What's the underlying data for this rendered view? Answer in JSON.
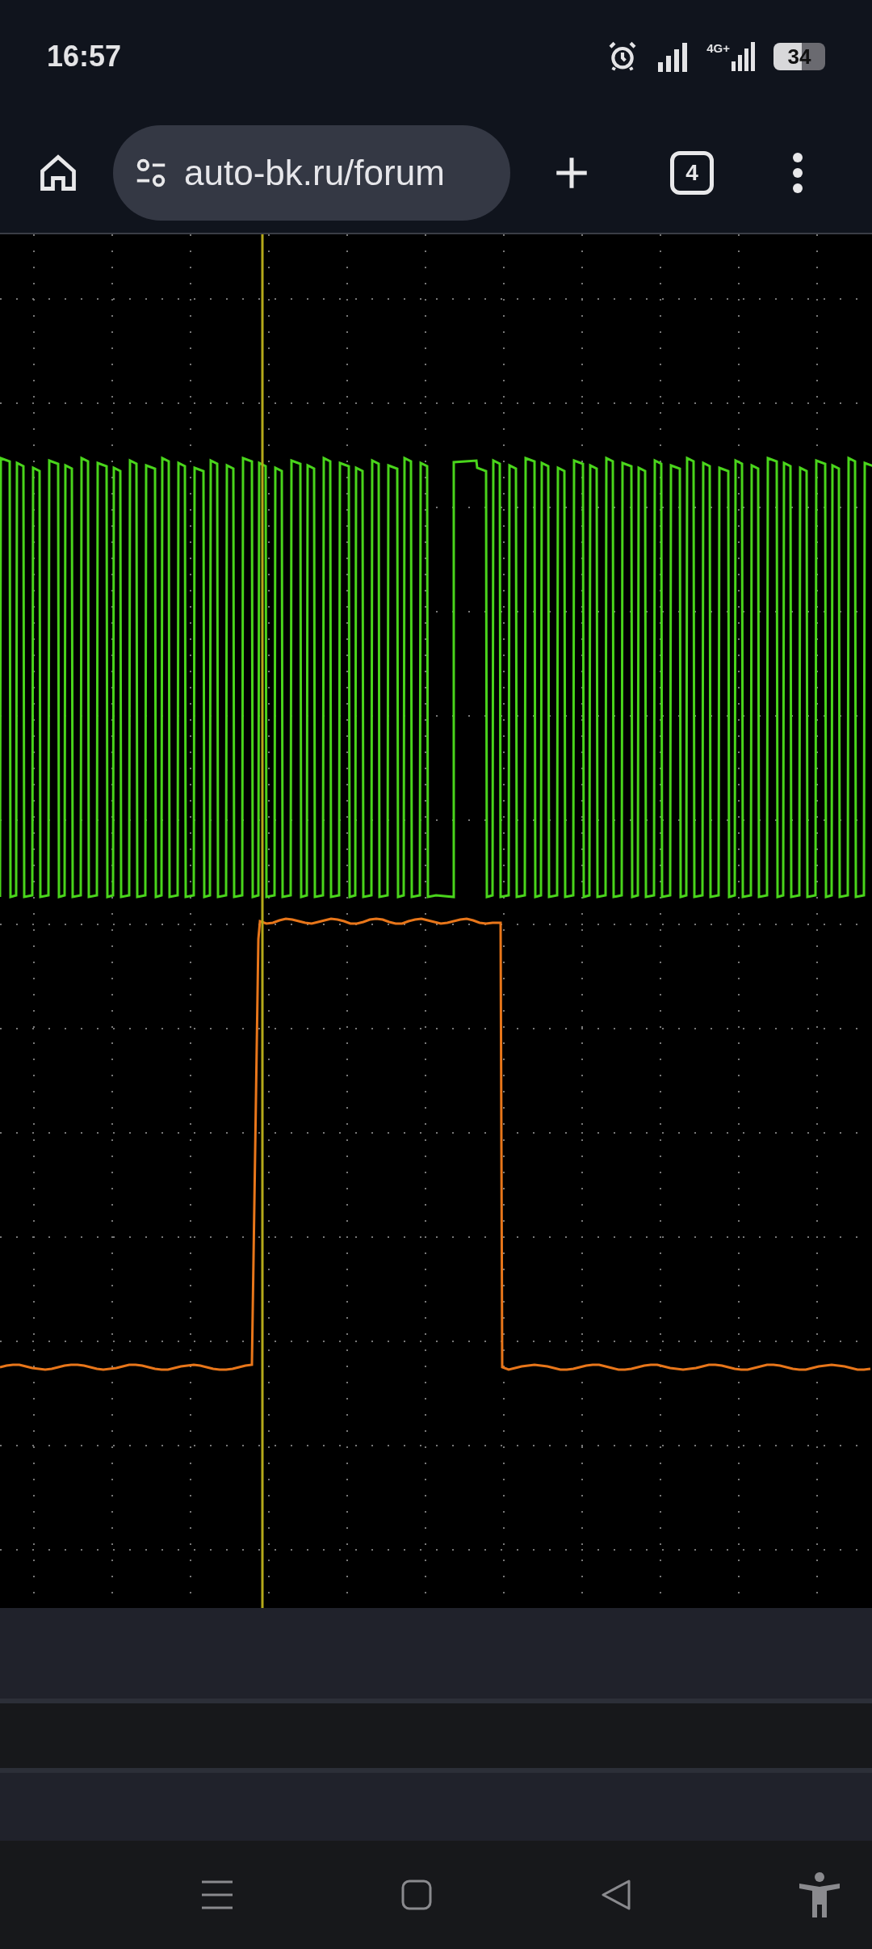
{
  "status_bar": {
    "time": "16:57",
    "network_type": "4G+",
    "battery": "34"
  },
  "browser_toolbar": {
    "url": "auto-bk.ru/forum",
    "tab_count": "4"
  }
}
